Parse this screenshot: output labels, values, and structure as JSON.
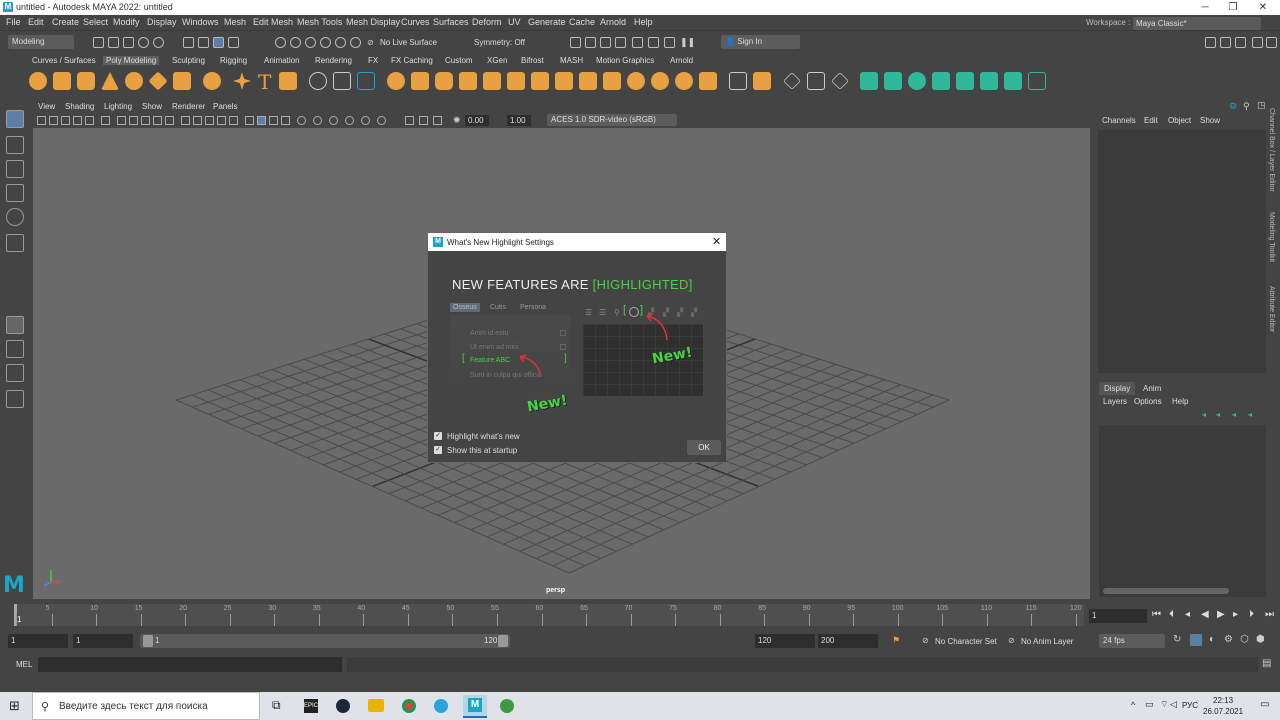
{
  "window": {
    "title": "untitled - Autodesk MAYA 2022: untitled",
    "logo": "M"
  },
  "menubar": {
    "items": [
      "File",
      "Edit",
      "Create",
      "Select",
      "Modify",
      "Display",
      "Windows",
      "Mesh",
      "Edit Mesh",
      "Mesh Tools",
      "Mesh Display",
      "Curves",
      "Surfaces",
      "Deform",
      "UV",
      "Generate",
      "Cache",
      "Arnold",
      "Help"
    ],
    "workspace_label": "Workspace :",
    "workspace_value": "Maya Classic*"
  },
  "statusline": {
    "mode": "Modeling",
    "live_surface": "No Live Surface",
    "symmetry": "Symmetry: Off",
    "sign_in": "Sign In"
  },
  "shelf": {
    "tabs": [
      "Curves / Surfaces",
      "Poly Modeling",
      "Sculpting",
      "Rigging",
      "Animation",
      "Rendering",
      "FX",
      "FX Caching",
      "Custom",
      "XGen",
      "Bifrost",
      "MASH",
      "Motion Graphics",
      "Arnold"
    ],
    "active_tab": "Poly Modeling"
  },
  "panel": {
    "menu": [
      "View",
      "Shading",
      "Lighting",
      "Show",
      "Renderer",
      "Panels"
    ],
    "exposure": "0.00",
    "gamma": "1.00",
    "color_space": "ACES 1.0 SDR-video (sRGB)",
    "camera_label": "persp"
  },
  "channelbox": {
    "menu": [
      "Channels",
      "Edit",
      "Object",
      "Show"
    ]
  },
  "layereditor": {
    "tabs": [
      "Display",
      "Anim"
    ],
    "menu": [
      "Layers",
      "Options",
      "Help"
    ]
  },
  "side_tabs": [
    "Channel Box / Layer Editor",
    "Modeling Toolkit",
    "Attribute Editor"
  ],
  "timeslider": {
    "ticks": [
      "1",
      "5",
      "10",
      "15",
      "20",
      "25",
      "30",
      "35",
      "40",
      "45",
      "50",
      "55",
      "60",
      "65",
      "70",
      "75",
      "80",
      "85",
      "90",
      "95",
      "100",
      "105",
      "110",
      "115",
      "120"
    ],
    "current_frame": "1"
  },
  "range": {
    "start": "1",
    "playback_start": "1",
    "slider_start": "1",
    "slider_end": "120",
    "playback_end": "120",
    "end": "200",
    "character_set": "No Character Set",
    "anim_layer": "No Anim Layer",
    "fps": "24 fps"
  },
  "cmdline": {
    "label": "MEL"
  },
  "dialog": {
    "title": "What's New Highlight Settings",
    "heading_prefix": "NEW FEATURES ARE ",
    "heading_highlight": "[HIGHLIGHTED]",
    "mini_tabs": [
      "Osseus",
      "Cutis",
      "Persona"
    ],
    "mini_items": [
      "Anim id estu",
      "Ut enim ad mini",
      "Feature ABC",
      "Sunt in culpa qui officia"
    ],
    "new_label_left": "New!",
    "new_label_right": "New!",
    "checkbox_highlight": "Highlight what's new",
    "checkbox_startup": "Show this at startup",
    "ok": "OK"
  },
  "taskbar": {
    "search_placeholder": "Введите здесь текст для поиска",
    "lang": "РУС",
    "time": "22:13",
    "date": "26.07.2021"
  },
  "colors": {
    "accent": "#47d147",
    "maya_blue": "#1aa7c7",
    "shelf_orange": "#e8a040",
    "viewport_bg": "#6a6a6a"
  }
}
